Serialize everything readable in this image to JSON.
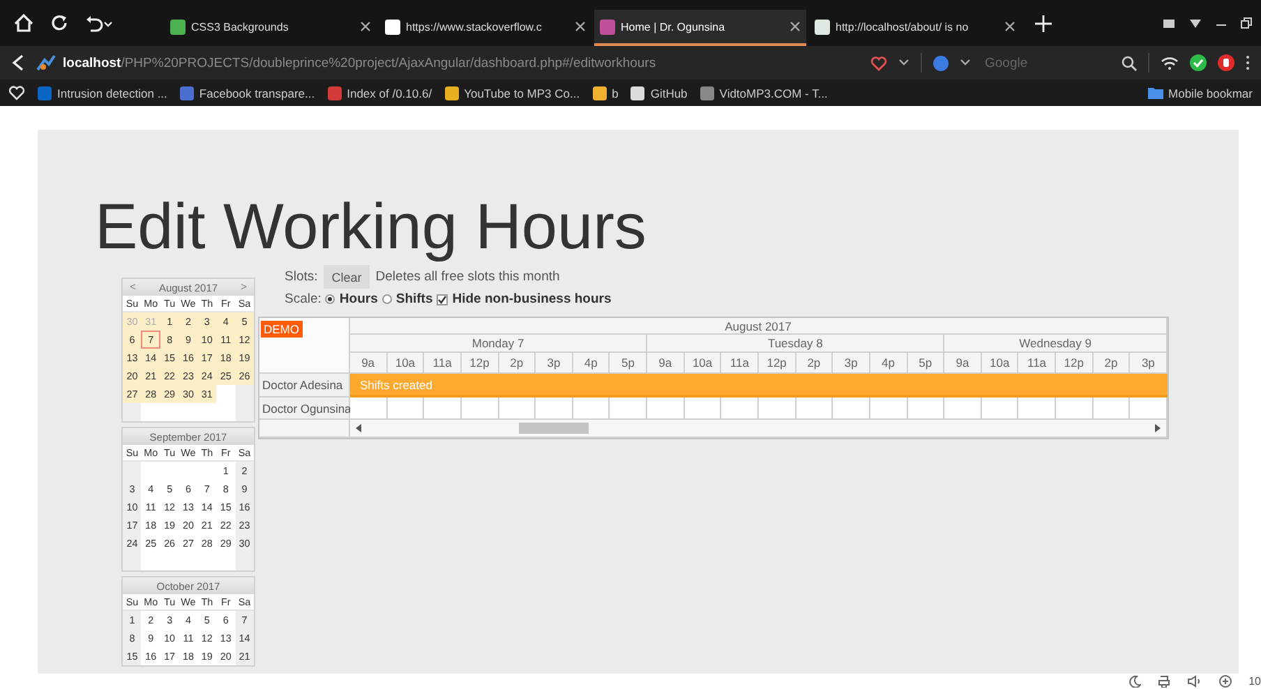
{
  "browser": {
    "tabs": [
      {
        "title": "CSS3 Backgrounds",
        "selected": false
      },
      {
        "title": "https://www.stackoverflow.c",
        "selected": false
      },
      {
        "title": "Home | Dr. Ogunsina",
        "selected": true
      },
      {
        "title": "http://localhost/about/ is no",
        "selected": false
      }
    ],
    "url": "**localhost**/PHP%20PROJECTS/doubleprince%20project/AjaxAngular/dashboard.php#/editworkhours",
    "search": {
      "placeholder": "Google"
    },
    "bookmarks": [
      {
        "label": "Intrusion detection ...",
        "color": "#0a66c2"
      },
      {
        "label": "Facebook transpare...",
        "color": "#4a6fd0"
      },
      {
        "label": "Index of /0.10.6/",
        "color": "#d33b3b"
      },
      {
        "label": "YouTube to MP3 Co...",
        "color": "#e8b020"
      },
      {
        "label": "b",
        "color": "#f0b030"
      },
      {
        "label": "GitHub",
        "color": "#dddddd"
      },
      {
        "label": "VidtoMP3.COM - T...",
        "color": "#888888"
      }
    ],
    "mobile_bookmarks": "Mobile bookmar"
  },
  "page": {
    "title": "Edit Working Hours",
    "calendar": [
      {
        "title": "August 2017",
        "prev": "<",
        "next": ">",
        "highlighted": true,
        "weekdays": [
          "Su",
          "Mo",
          "Tu",
          "We",
          "Th",
          "Fr",
          "Sa"
        ],
        "weeks": [
          [
            {
              "day": "30",
              "outside": true,
              "selected": false
            },
            {
              "day": "31",
              "outside": true,
              "selected": false
            },
            {
              "day": "1",
              "outside": false,
              "selected": false
            },
            {
              "day": "2",
              "outside": false,
              "selected": false
            },
            {
              "day": "3",
              "outside": false,
              "selected": false
            },
            {
              "day": "4",
              "outside": false,
              "selected": false
            },
            {
              "day": "5",
              "outside": false,
              "selected": false
            }
          ],
          [
            {
              "day": "6",
              "outside": false,
              "selected": false
            },
            {
              "day": "7",
              "outside": false,
              "selected": true
            },
            {
              "day": "8",
              "outside": false,
              "selected": false
            },
            {
              "day": "9",
              "outside": false,
              "selected": false
            },
            {
              "day": "10",
              "outside": false,
              "selected": false
            },
            {
              "day": "11",
              "outside": false,
              "selected": false
            },
            {
              "day": "12",
              "outside": false,
              "selected": false
            }
          ],
          [
            {
              "day": "13",
              "outside": false,
              "selected": false
            },
            {
              "day": "14",
              "outside": false,
              "selected": false
            },
            {
              "day": "15",
              "outside": false,
              "selected": false
            },
            {
              "day": "16",
              "outside": false,
              "selected": false
            },
            {
              "day": "17",
              "outside": false,
              "selected": false
            },
            {
              "day": "18",
              "outside": false,
              "selected": false
            },
            {
              "day": "19",
              "outside": false,
              "selected": false
            }
          ],
          [
            {
              "day": "20",
              "outside": false,
              "selected": false
            },
            {
              "day": "21",
              "outside": false,
              "selected": false
            },
            {
              "day": "22",
              "outside": false,
              "selected": false
            },
            {
              "day": "23",
              "outside": false,
              "selected": false
            },
            {
              "day": "24",
              "outside": false,
              "selected": false
            },
            {
              "day": "25",
              "outside": false,
              "selected": false
            },
            {
              "day": "26",
              "outside": false,
              "selected": false
            }
          ],
          [
            {
              "day": "27",
              "outside": false,
              "selected": false
            },
            {
              "day": "28",
              "outside": false,
              "selected": false
            },
            {
              "day": "29",
              "outside": false,
              "selected": false
            },
            {
              "day": "30",
              "outside": false,
              "selected": false
            },
            {
              "day": "31",
              "outside": false,
              "selected": false
            }
          ]
        ]
      },
      {
        "title": "September 2017",
        "highlighted": false,
        "weekdays": [
          "Su",
          "Mo",
          "Tu",
          "We",
          "Th",
          "Fr",
          "Sa"
        ],
        "weeks": [
          [
            {
              "day": "1",
              "outside": false,
              "selected": false
            },
            {
              "day": "2",
              "outside": false,
              "selected": false
            }
          ],
          [
            {
              "day": "3",
              "outside": false,
              "selected": false
            },
            {
              "day": "4",
              "outside": false,
              "selected": false
            },
            {
              "day": "5",
              "outside": false,
              "selected": false
            },
            {
              "day": "6",
              "outside": false,
              "selected": false
            },
            {
              "day": "7",
              "outside": false,
              "selected": false
            },
            {
              "day": "8",
              "outside": false,
              "selected": false
            },
            {
              "day": "9",
              "outside": false,
              "selected": false
            }
          ],
          [
            {
              "day": "10",
              "outside": false,
              "selected": false
            },
            {
              "day": "11",
              "outside": false,
              "selected": false
            },
            {
              "day": "12",
              "outside": false,
              "selected": false
            },
            {
              "day": "13",
              "outside": false,
              "selected": false
            },
            {
              "day": "14",
              "outside": false,
              "selected": false
            },
            {
              "day": "15",
              "outside": false,
              "selected": false
            },
            {
              "day": "16",
              "outside": false,
              "selected": false
            }
          ],
          [
            {
              "day": "17",
              "outside": false,
              "selected": false
            },
            {
              "day": "18",
              "outside": false,
              "selected": false
            },
            {
              "day": "19",
              "outside": false,
              "selected": false
            },
            {
              "day": "20",
              "outside": false,
              "selected": false
            },
            {
              "day": "21",
              "outside": false,
              "selected": false
            },
            {
              "day": "22",
              "outside": false,
              "selected": false
            },
            {
              "day": "23",
              "outside": false,
              "selected": false
            }
          ],
          [
            {
              "day": "24",
              "outside": false,
              "selected": false
            },
            {
              "day": "25",
              "outside": false,
              "selected": false
            },
            {
              "day": "26",
              "outside": false,
              "selected": false
            },
            {
              "day": "27",
              "outside": false,
              "selected": false
            },
            {
              "day": "28",
              "outside": false,
              "selected": false
            },
            {
              "day": "29",
              "outside": false,
              "selected": false
            },
            {
              "day": "30",
              "outside": false,
              "selected": false
            }
          ]
        ]
      },
      {
        "title": "October 2017",
        "highlighted": false,
        "weekdays": [
          "Su",
          "Mo",
          "Tu",
          "We",
          "Th",
          "Fr",
          "Sa"
        ],
        "weeks": [
          [
            {
              "day": "1",
              "outside": false,
              "selected": false
            },
            {
              "day": "2",
              "outside": false,
              "selected": false
            },
            {
              "day": "3",
              "outside": false,
              "selected": false
            },
            {
              "day": "4",
              "outside": false,
              "selected": false
            },
            {
              "day": "5",
              "outside": false,
              "selected": false
            },
            {
              "day": "6",
              "outside": false,
              "selected": false
            },
            {
              "day": "7",
              "outside": false,
              "selected": false
            }
          ],
          [
            {
              "day": "8",
              "outside": false,
              "selected": false
            },
            {
              "day": "9",
              "outside": false,
              "selected": false
            },
            {
              "day": "10",
              "outside": false,
              "selected": false
            },
            {
              "day": "11",
              "outside": false,
              "selected": false
            },
            {
              "day": "12",
              "outside": false,
              "selected": false
            },
            {
              "day": "13",
              "outside": false,
              "selected": false
            },
            {
              "day": "14",
              "outside": false,
              "selected": false
            }
          ],
          [
            {
              "day": "15",
              "outside": false,
              "selected": false
            },
            {
              "day": "16",
              "outside": false,
              "selected": false
            },
            {
              "day": "17",
              "outside": false,
              "selected": false
            },
            {
              "day": "18",
              "outside": false,
              "selected": false
            },
            {
              "day": "19",
              "outside": false,
              "selected": false
            },
            {
              "day": "20",
              "outside": false,
              "selected": false
            },
            {
              "day": "21",
              "outside": false,
              "selected": false
            }
          ]
        ]
      }
    ],
    "slots": {
      "label": "Slots:",
      "button": "Clear",
      "hint": "Deletes all free slots this month"
    },
    "scale": {
      "label": "Scale:",
      "options": [
        {
          "label": "Hours",
          "selected": true
        },
        {
          "label": "Shifts",
          "selected": false
        }
      ],
      "hide_non_business": {
        "label": "Hide non-business hours",
        "checked": true
      }
    },
    "scheduler": {
      "badge": "DEMO",
      "month": "August 2017",
      "days": [
        {
          "label": "Monday 7",
          "hours": [
            "9a",
            "10a",
            "11a",
            "12p",
            "2p",
            "3p",
            "4p",
            "5p"
          ]
        },
        {
          "label": "Tuesday 8",
          "hours": [
            "9a",
            "10a",
            "11a",
            "12p",
            "2p",
            "3p",
            "4p",
            "5p"
          ]
        },
        {
          "label": "Wednesday 9",
          "hours": [
            "9a",
            "10a",
            "11a",
            "12p",
            "2p",
            "3p"
          ]
        }
      ],
      "rows": [
        {
          "name": "Doctor Adesina",
          "event": "Shifts created"
        },
        {
          "name": "Doctor Ogunsina"
        }
      ]
    }
  },
  "zoom_level": "10"
}
